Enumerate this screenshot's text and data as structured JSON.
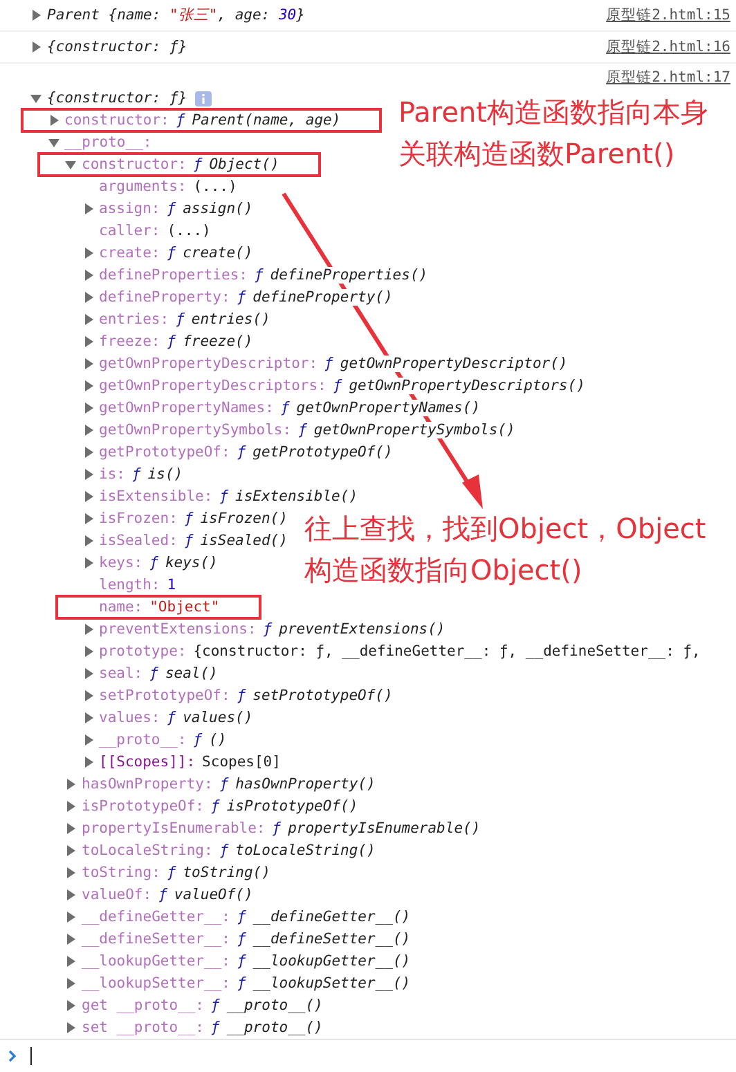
{
  "messages": [
    {
      "expanded": false,
      "source": "原型链2.html:15",
      "parts": [
        {
          "kind": "plain",
          "text": "Parent {name: "
        },
        {
          "kind": "string",
          "text": "\"张三\""
        },
        {
          "kind": "plain",
          "text": ", age: "
        },
        {
          "kind": "number",
          "text": "30"
        },
        {
          "kind": "plain",
          "text": "}"
        }
      ]
    },
    {
      "expanded": false,
      "source": "原型链2.html:16",
      "parts": [
        {
          "kind": "plain",
          "text": "{constructor: ƒ}"
        }
      ]
    },
    {
      "source": "原型链2.html:17",
      "tree": {
        "expanded": true,
        "kind": "preview",
        "value": "{constructor: ƒ}",
        "info": true,
        "children": [
          {
            "expanded": false,
            "key": "constructor:",
            "kind": "function",
            "prefix": "ƒ",
            "value": "Parent(name, age)",
            "highlighted": true
          },
          {
            "expanded": true,
            "key": "__proto__:",
            "kind": "hidden",
            "children": [
              {
                "expanded": true,
                "key": "constructor:",
                "kind": "function",
                "prefix": "ƒ",
                "value": "Object()",
                "highlighted": true,
                "children": [
                  {
                    "key": "arguments:",
                    "kind": "accessor",
                    "value": "(...)"
                  },
                  {
                    "expanded": false,
                    "key": "assign:",
                    "kind": "function",
                    "prefix": "ƒ",
                    "value": "assign()"
                  },
                  {
                    "key": "caller:",
                    "kind": "accessor",
                    "value": "(...)"
                  },
                  {
                    "expanded": false,
                    "key": "create:",
                    "kind": "function",
                    "prefix": "ƒ",
                    "value": "create()"
                  },
                  {
                    "expanded": false,
                    "key": "defineProperties:",
                    "kind": "function",
                    "prefix": "ƒ",
                    "value": "defineProperties()"
                  },
                  {
                    "expanded": false,
                    "key": "defineProperty:",
                    "kind": "function",
                    "prefix": "ƒ",
                    "value": "defineProperty()"
                  },
                  {
                    "expanded": false,
                    "key": "entries:",
                    "kind": "function",
                    "prefix": "ƒ",
                    "value": "entries()"
                  },
                  {
                    "expanded": false,
                    "key": "freeze:",
                    "kind": "function",
                    "prefix": "ƒ",
                    "value": "freeze()"
                  },
                  {
                    "expanded": false,
                    "key": "getOwnPropertyDescriptor:",
                    "kind": "function",
                    "prefix": "ƒ",
                    "value": "getOwnPropertyDescriptor()"
                  },
                  {
                    "expanded": false,
                    "key": "getOwnPropertyDescriptors:",
                    "kind": "function",
                    "prefix": "ƒ",
                    "value": "getOwnPropertyDescriptors()"
                  },
                  {
                    "expanded": false,
                    "key": "getOwnPropertyNames:",
                    "kind": "function",
                    "prefix": "ƒ",
                    "value": "getOwnPropertyNames()"
                  },
                  {
                    "expanded": false,
                    "key": "getOwnPropertySymbols:",
                    "kind": "function",
                    "prefix": "ƒ",
                    "value": "getOwnPropertySymbols()"
                  },
                  {
                    "expanded": false,
                    "key": "getPrototypeOf:",
                    "kind": "function",
                    "prefix": "ƒ",
                    "value": "getPrototypeOf()"
                  },
                  {
                    "expanded": false,
                    "key": "is:",
                    "kind": "function",
                    "prefix": "ƒ",
                    "value": "is()"
                  },
                  {
                    "expanded": false,
                    "key": "isExtensible:",
                    "kind": "function",
                    "prefix": "ƒ",
                    "value": "isExtensible()"
                  },
                  {
                    "expanded": false,
                    "key": "isFrozen:",
                    "kind": "function",
                    "prefix": "ƒ",
                    "value": "isFrozen()"
                  },
                  {
                    "expanded": false,
                    "key": "isSealed:",
                    "kind": "function",
                    "prefix": "ƒ",
                    "value": "isSealed()"
                  },
                  {
                    "expanded": false,
                    "key": "keys:",
                    "kind": "function",
                    "prefix": "ƒ",
                    "value": "keys()"
                  },
                  {
                    "key": "length:",
                    "kind": "number",
                    "value": "1"
                  },
                  {
                    "key": "name:",
                    "kind": "string",
                    "value": "\"Object\"",
                    "highlighted": true
                  },
                  {
                    "expanded": false,
                    "key": "preventExtensions:",
                    "kind": "function",
                    "prefix": "ƒ",
                    "value": "preventExtensions()"
                  },
                  {
                    "expanded": false,
                    "key": "prototype:",
                    "kind": "object",
                    "value": "{constructor: ƒ, __defineGetter__: ƒ, __defineSetter__: ƒ,"
                  },
                  {
                    "expanded": false,
                    "key": "seal:",
                    "kind": "function",
                    "prefix": "ƒ",
                    "value": "seal()"
                  },
                  {
                    "expanded": false,
                    "key": "setPrototypeOf:",
                    "kind": "function",
                    "prefix": "ƒ",
                    "value": "setPrototypeOf()"
                  },
                  {
                    "expanded": false,
                    "key": "values:",
                    "kind": "function",
                    "prefix": "ƒ",
                    "value": "values()"
                  },
                  {
                    "expanded": false,
                    "key": "__proto__:",
                    "kind": "function",
                    "prefix": "ƒ",
                    "value": "()"
                  },
                  {
                    "expanded": false,
                    "key": "[[Scopes]]:",
                    "kind": "internal",
                    "value": "Scopes[0]"
                  }
                ]
              },
              {
                "expanded": false,
                "key": "hasOwnProperty:",
                "kind": "function",
                "prefix": "ƒ",
                "value": "hasOwnProperty()"
              },
              {
                "expanded": false,
                "key": "isPrototypeOf:",
                "kind": "function",
                "prefix": "ƒ",
                "value": "isPrototypeOf()"
              },
              {
                "expanded": false,
                "key": "propertyIsEnumerable:",
                "kind": "function",
                "prefix": "ƒ",
                "value": "propertyIsEnumerable()"
              },
              {
                "expanded": false,
                "key": "toLocaleString:",
                "kind": "function",
                "prefix": "ƒ",
                "value": "toLocaleString()"
              },
              {
                "expanded": false,
                "key": "toString:",
                "kind": "function",
                "prefix": "ƒ",
                "value": "toString()"
              },
              {
                "expanded": false,
                "key": "valueOf:",
                "kind": "function",
                "prefix": "ƒ",
                "value": "valueOf()"
              },
              {
                "expanded": false,
                "key": "__defineGetter__:",
                "kind": "function",
                "prefix": "ƒ",
                "value": "__defineGetter__()"
              },
              {
                "expanded": false,
                "key": "__defineSetter__:",
                "kind": "function",
                "prefix": "ƒ",
                "value": "__defineSetter__()"
              },
              {
                "expanded": false,
                "key": "__lookupGetter__:",
                "kind": "function",
                "prefix": "ƒ",
                "value": "__lookupGetter__()"
              },
              {
                "expanded": false,
                "key": "__lookupSetter__:",
                "kind": "function",
                "prefix": "ƒ",
                "value": "__lookupSetter__()"
              },
              {
                "expanded": false,
                "key": "get __proto__:",
                "kind": "function",
                "prefix": "ƒ",
                "value": "__proto__()"
              },
              {
                "expanded": false,
                "key": "set __proto__:",
                "kind": "function",
                "prefix": "ƒ",
                "value": "__proto__()"
              }
            ]
          }
        ]
      }
    }
  ],
  "callouts": [
    {
      "lines": [
        "Parent构造函数指向本身",
        "关联构造函数Parent()"
      ]
    },
    {
      "lines": [
        "往上查找，找到Object，Object",
        "构造函数指向Object()"
      ]
    }
  ]
}
